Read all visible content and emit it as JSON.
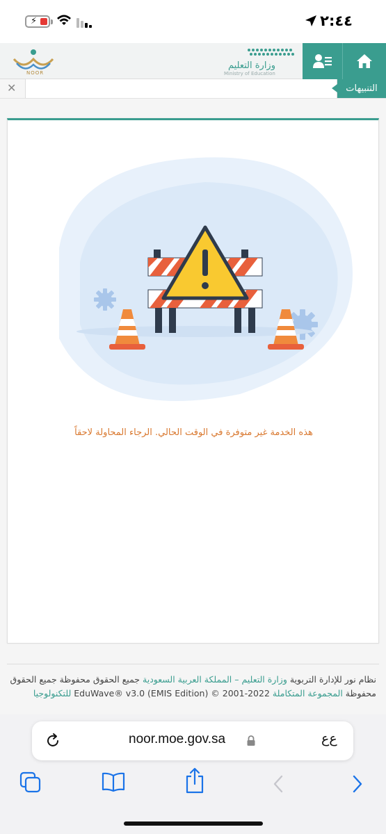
{
  "status_bar": {
    "time": "٢:٤٤"
  },
  "header": {
    "moe_name_ar": "وزارة التعليم",
    "moe_name_en": "Ministry of Education",
    "noor_label": "NOOR",
    "home_icon": "home-icon",
    "users_icon": "users-list-icon",
    "accent_color": "#3a9d8f"
  },
  "alerts": {
    "tab_label": "التنبيهات",
    "close_label": "✕"
  },
  "main": {
    "error_message": "هذه الخدمة غير متوفرة في الوقت الحالي. الرجاء المحاولة لاحقاً"
  },
  "footer": {
    "text_1": "نظام نور للإدارة التربوية ",
    "link_1": "وزارة التعليم – المملكة العربية السعودية",
    "text_2": " جميع الحقوق محفوظة جميع الحقوق محفوظة ",
    "link_2": "المجموعة المتكاملة",
    "text_3": " EduWave® v3.0 (EMIS Edition) © 2001-2022 ",
    "link_3": "للتكنولوجيا"
  },
  "browser": {
    "url": "noor.moe.gov.sa",
    "aa_label": "ﻉﻉ"
  }
}
